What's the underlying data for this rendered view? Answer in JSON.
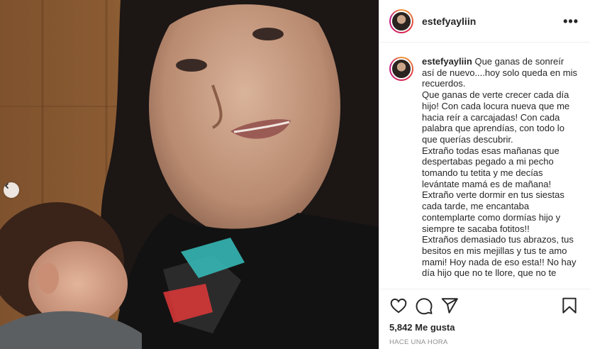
{
  "post": {
    "username": "estefyayliin",
    "caption_username": "estefyayliin",
    "caption_text": "Que ganas de sonreír así de nuevo....hoy solo queda en mis recuerdos.\nQue ganas de verte crecer cada día hijo! Con cada locura nueva que me hacia reír a carcajadas! Con cada palabra que aprendías, con todo lo que querías descubrir.\nExtraño todas esas mañanas que despertabas pegado a mi pecho tomando tu tetita y me decías levántate mamá es de mañana!\nExtraño verte dormir en tus siestas cada tarde, me encantaba contemplarte como dormías hijo y siempre te sacaba fotitos!!\nExtraños demasiado tus abrazos, tus besitos en mis mejillas y tus te amo mami! Hoy nada de eso esta!! No hay día hijo que no te llore, que no te",
    "likes": "5,842 Me gusta",
    "timestamp": "HACE UNA HORA"
  },
  "icons": {
    "more": "more-options-icon",
    "prev": "chevron-left-icon",
    "like": "heart-icon",
    "comment": "comment-icon",
    "share": "paper-plane-icon",
    "save": "bookmark-icon"
  },
  "colors": {
    "text": "#262626",
    "muted": "#8e8e8e",
    "border": "#efefef"
  }
}
